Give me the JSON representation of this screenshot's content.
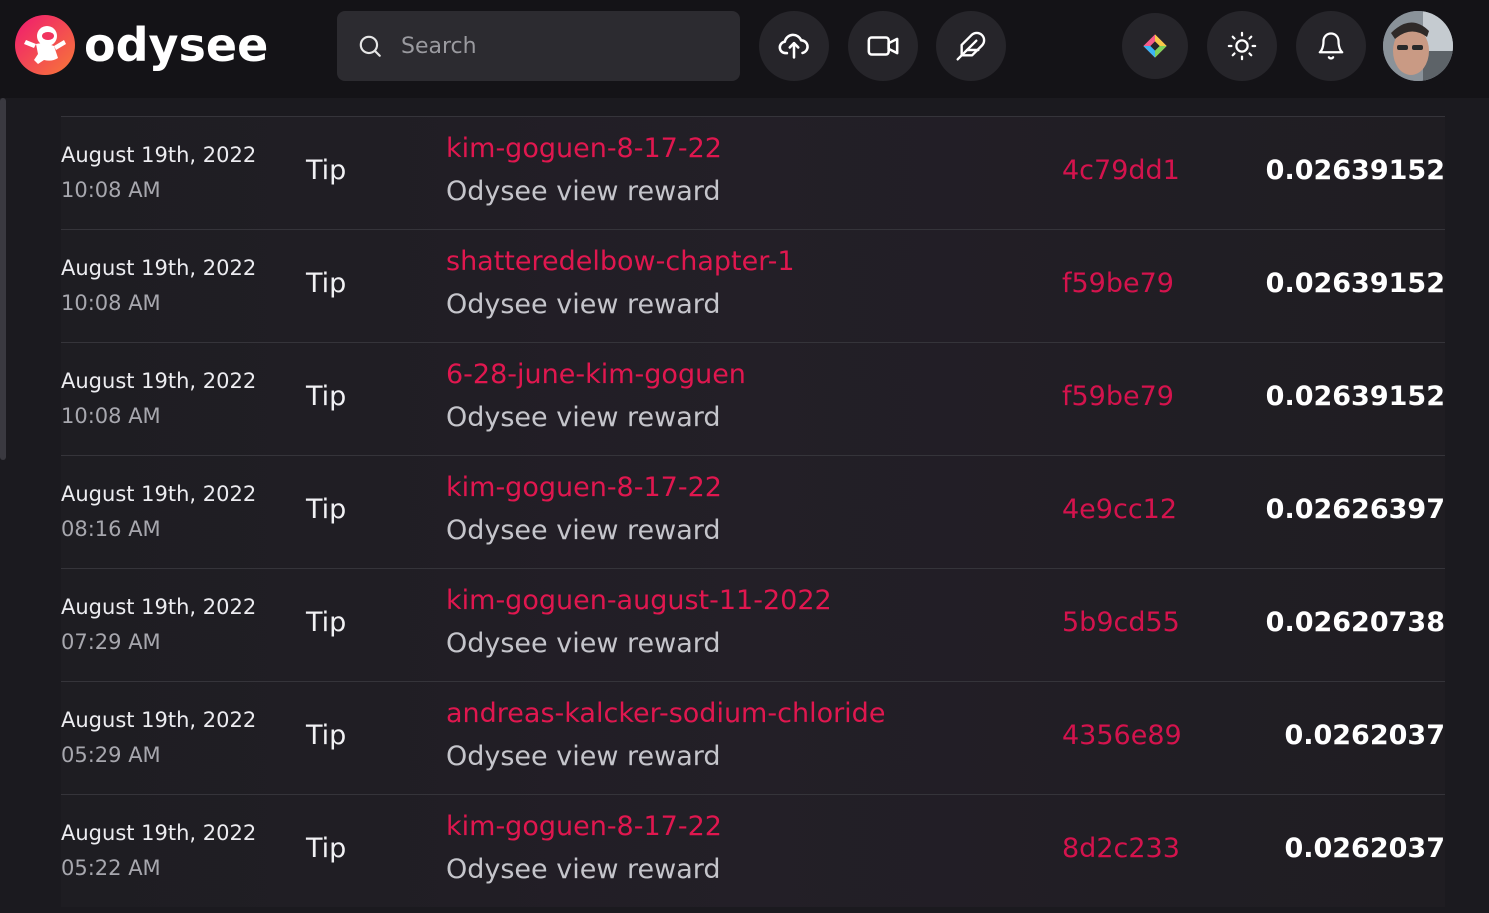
{
  "app": {
    "logo_text": "odysee"
  },
  "search": {
    "placeholder": "Search"
  },
  "header_buttons": [
    {
      "icon": "upload-cloud-icon"
    },
    {
      "icon": "video-camera-icon"
    },
    {
      "icon": "feather-pen-icon"
    },
    {
      "icon": "premium-diamond-icon"
    },
    {
      "icon": "sun-icon"
    },
    {
      "icon": "bell-icon"
    }
  ],
  "colors": {
    "accent": "#e0174f",
    "background": "#1b1a1f",
    "header": "#141317"
  },
  "transactions": [
    {
      "date": "August 19th, 2022",
      "time": "10:08 AM",
      "type": "Tip",
      "claim": "kim-goguen-8-17-22",
      "description": "Odysee view reward",
      "txid": "4c79dd1",
      "amount": "0.02639152"
    },
    {
      "date": "August 19th, 2022",
      "time": "10:08 AM",
      "type": "Tip",
      "claim": "shatteredelbow-chapter-1",
      "description": "Odysee view reward",
      "txid": "f59be79",
      "amount": "0.02639152"
    },
    {
      "date": "August 19th, 2022",
      "time": "10:08 AM",
      "type": "Tip",
      "claim": "6-28-june-kim-goguen",
      "description": "Odysee view reward",
      "txid": "f59be79",
      "amount": "0.02639152"
    },
    {
      "date": "August 19th, 2022",
      "time": "08:16 AM",
      "type": "Tip",
      "claim": "kim-goguen-8-17-22",
      "description": "Odysee view reward",
      "txid": "4e9cc12",
      "amount": "0.02626397"
    },
    {
      "date": "August 19th, 2022",
      "time": "07:29 AM",
      "type": "Tip",
      "claim": "kim-goguen-august-11-2022",
      "description": "Odysee view reward",
      "txid": "5b9cd55",
      "amount": "0.02620738"
    },
    {
      "date": "August 19th, 2022",
      "time": "05:29 AM",
      "type": "Tip",
      "claim": "andreas-kalcker-sodium-chloride",
      "description": "Odysee view reward",
      "txid": "4356e89",
      "amount": "0.0262037"
    },
    {
      "date": "August 19th, 2022",
      "time": "05:22 AM",
      "type": "Tip",
      "claim": "kim-goguen-8-17-22",
      "description": "Odysee view reward",
      "txid": "8d2c233",
      "amount": "0.0262037"
    }
  ]
}
